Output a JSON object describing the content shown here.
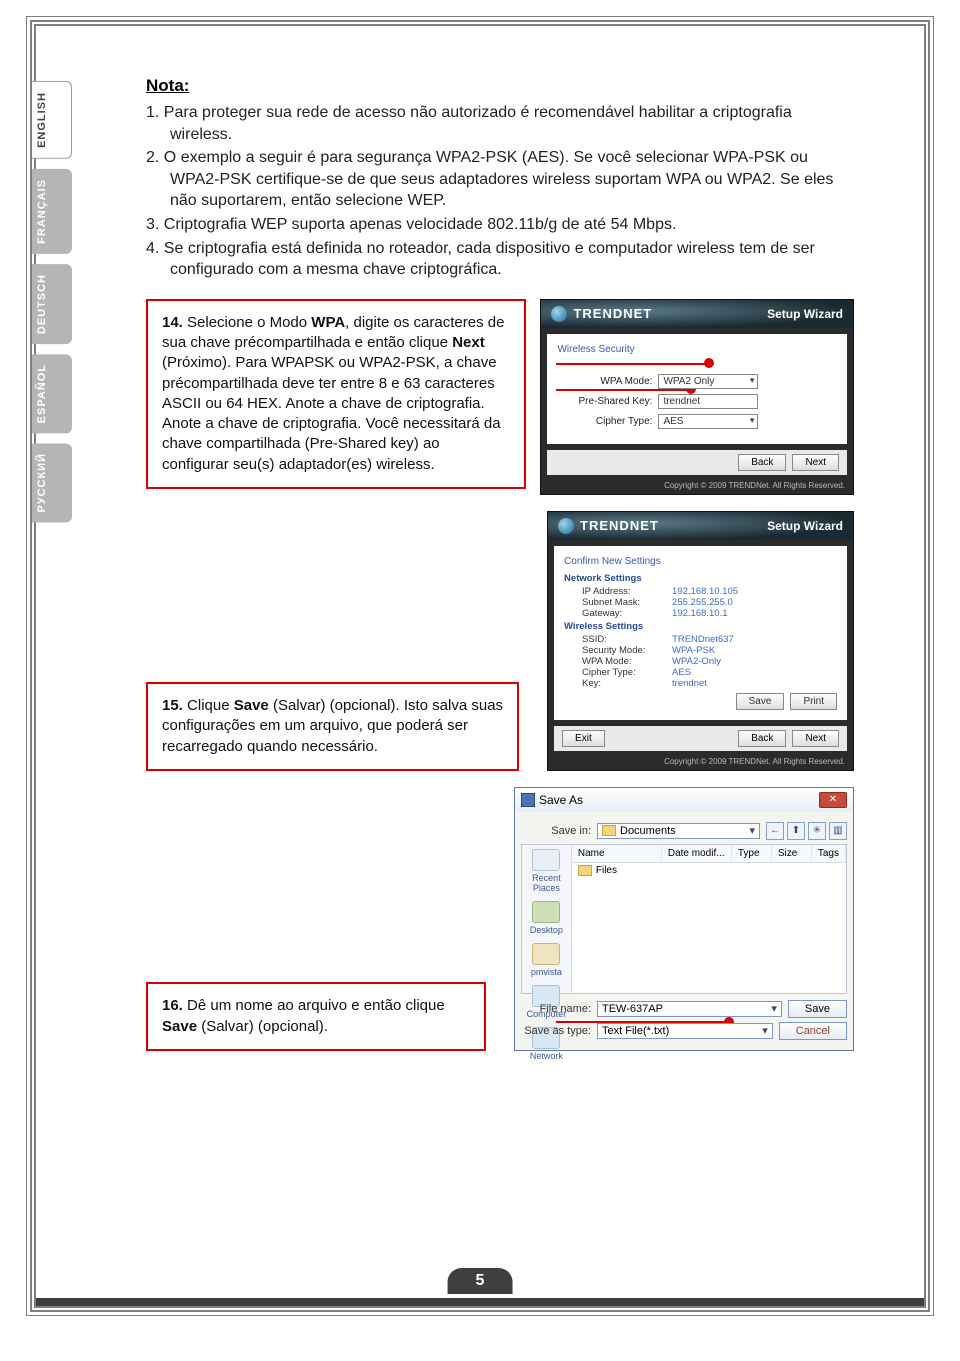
{
  "side_tabs": {
    "english": "ENGLISH",
    "francais": "FRANÇAIS",
    "deutsch": "DEUTSCH",
    "espanol": "ESPAÑOL",
    "russian": "РУССКИЙ"
  },
  "nota": {
    "title": "Nota:",
    "item1_no": "1. ",
    "item1": "Para proteger sua rede de acesso não autorizado é recomendável habilitar a criptografia wireless.",
    "item2_no": "2. ",
    "item2": "O exemplo a seguir é para segurança WPA2-PSK (AES). Se você selecionar WPA-PSK ou WPA2-PSK certifique-se de que seus adaptadores wireless suportam WPA ou WPA2. Se eles não suportarem, então selecione WEP.",
    "item3_no": "3. ",
    "item3": "Criptografia WEP suporta apenas velocidade 802.11b/g de até 54 Mbps.",
    "item4_no": "4. ",
    "item4": "Se criptografia está definida no roteador, cada dispositivo e computador wireless tem de ser configurado com a mesma chave criptográfica."
  },
  "step14": {
    "no": "14.",
    "p1a": "Selecione o Modo ",
    "p1b": "WPA",
    "p1c": ", digite os caracteres de sua chave précompartilhada e então clique ",
    "p1d": "Next",
    "p1e": " (Próximo). Para WPAPSK ou WPA2-PSK, a chave précompartilhada deve ter entre 8 e 63 caracteres ASCII ou 64 HEX. Anote a chave de criptografia. Anote a chave de criptografia. Você necessitará da chave compartilhada (Pre-Shared key) ao configurar seu(s) adaptador(es) wireless."
  },
  "step15": {
    "no": "15.",
    "p1a": "Clique ",
    "p1b": "Save",
    "p1c": " (Salvar) (opcional). Isto salva suas configurações em um arquivo, que poderá ser recarregado quando necessário."
  },
  "step16": {
    "no": "16.",
    "p1a": "Dê um nome ao arquivo e então clique ",
    "p1b": "Save",
    "p1c": " (Salvar) (opcional)."
  },
  "wizard": {
    "brand": "TRENDNET",
    "title": "Setup Wizard",
    "security_section": "Wireless Security",
    "wpa_mode_label": "WPA Mode:",
    "wpa_mode_value": "WPA2 Only",
    "psk_label": "Pre-Shared Key:",
    "psk_value": "trendnet",
    "cipher_label": "Cipher Type:",
    "cipher_value": "AES",
    "back": "Back",
    "next": "Next",
    "exit": "Exit",
    "copyright": "Copyright © 2009 TRENDNet. All Rights Reserved."
  },
  "confirm": {
    "section": "Confirm New Settings",
    "net_hdr": "Network Settings",
    "ip_k": "IP Address:",
    "ip_v": "192.168.10.105",
    "mask_k": "Subnet Mask:",
    "mask_v": "255.255.255.0",
    "gw_k": "Gateway:",
    "gw_v": "192.168.10.1",
    "wl_hdr": "Wireless Settings",
    "ssid_k": "SSID:",
    "ssid_v": "TRENDnet637",
    "sec_k": "Security Mode:",
    "sec_v": "WPA-PSK",
    "wpa_k": "WPA Mode:",
    "wpa_v": "WPA2-Only",
    "cip_k": "Cipher Type:",
    "cip_v": "AES",
    "key_k": "Key:",
    "key_v": "trendnet",
    "save": "Save",
    "print": "Print"
  },
  "saveas": {
    "title": "Save As",
    "savein_label": "Save in:",
    "savein_value": "Documents",
    "col_name": "Name",
    "col_date": "Date modif...",
    "col_type": "Type",
    "col_size": "Size",
    "col_tags": "Tags",
    "file_entry": "Files",
    "places": {
      "recent": "Recent Places",
      "desktop": "Desktop",
      "pmvista": "pmvista",
      "computer": "Computer",
      "network": "Network"
    },
    "filename_label": "File name:",
    "filename_value": "TEW-637AP",
    "savetype_label": "Save as type:",
    "savetype_value": "Text File(*.txt)",
    "save_btn": "Save",
    "cancel_btn": "Cancel"
  },
  "page_number": "5"
}
